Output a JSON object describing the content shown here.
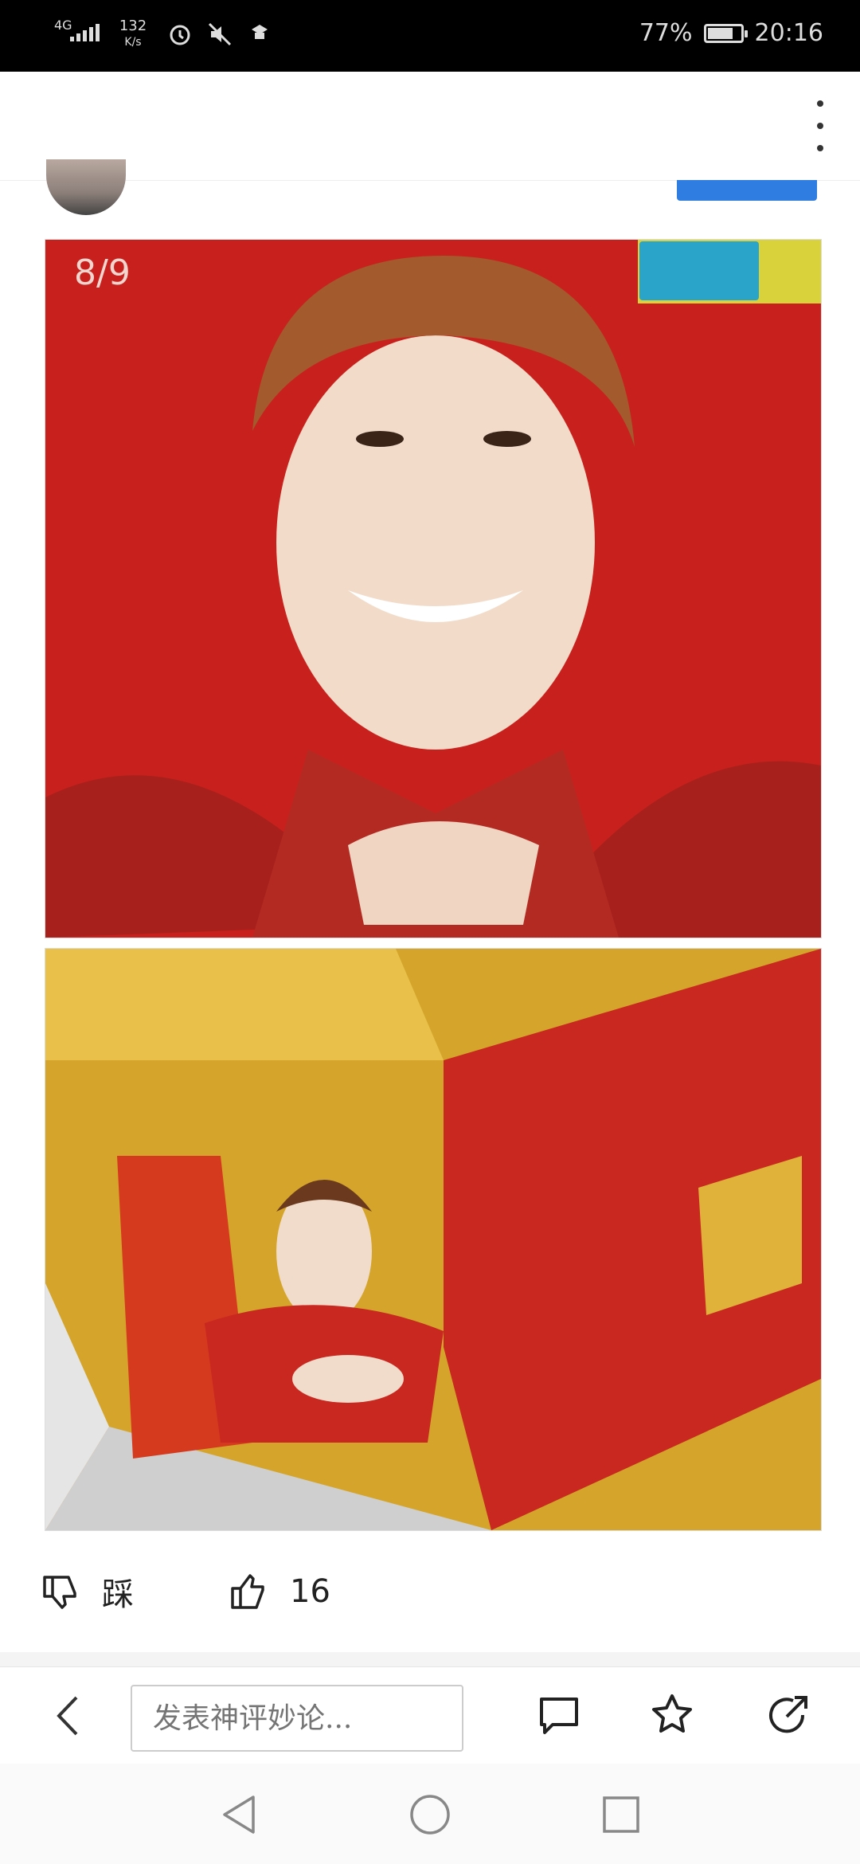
{
  "status_bar": {
    "network": "4G",
    "speed_value": "132",
    "speed_unit": "K/s",
    "battery": "77%",
    "battery_level": 0.77,
    "time": "20:16"
  },
  "post": {
    "image_counter": "8/9"
  },
  "actions": {
    "dislike_label": "踩",
    "like_count": "16"
  },
  "bottom_bar": {
    "comment_placeholder": "发表神评妙论..."
  },
  "icons": {
    "back": "back-arrow-icon",
    "comment": "comment-icon",
    "favorite": "star-icon",
    "share": "share-icon",
    "dislike": "thumbs-down-icon",
    "like": "thumbs-up-icon"
  },
  "colors": {
    "accent": "#2f7de1",
    "status_bar_bg": "#000000"
  }
}
